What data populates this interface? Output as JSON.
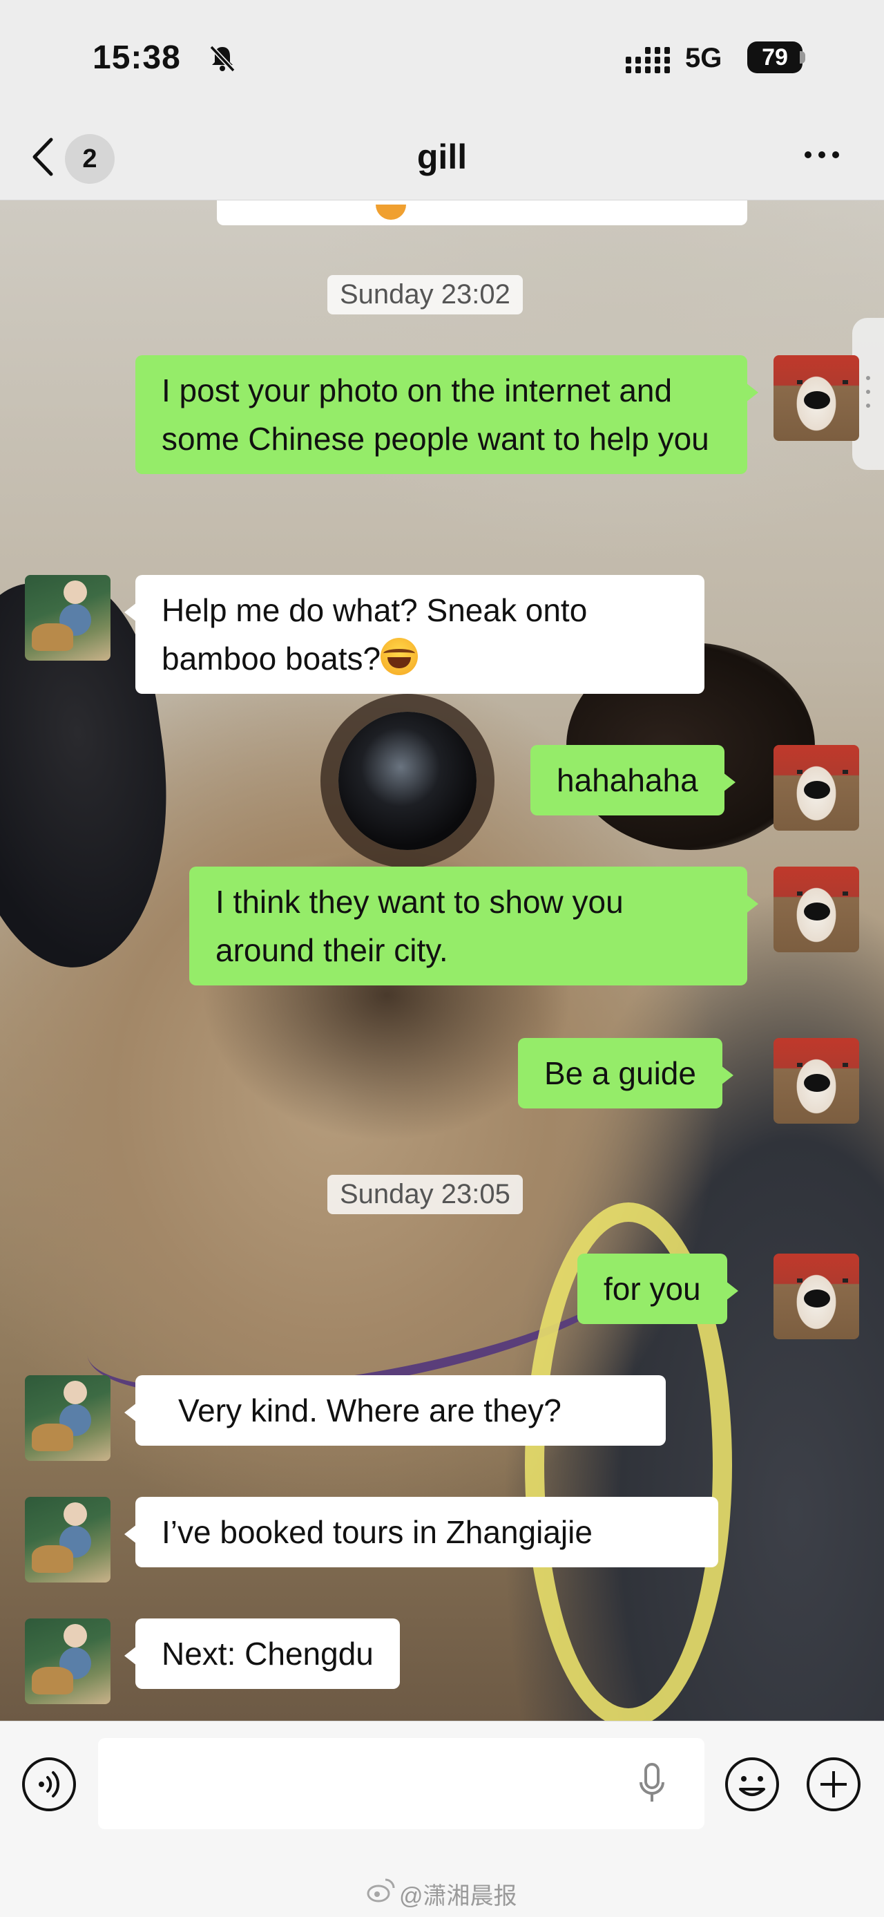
{
  "status_bar": {
    "time": "15:38",
    "network": "5G",
    "battery": "79",
    "icons": [
      "bell-muted-icon",
      "signal-icon",
      "battery-icon"
    ]
  },
  "nav": {
    "unread_count": "2",
    "title": "gill",
    "icons": [
      "back-arrow-icon",
      "more-icon"
    ]
  },
  "messages": [
    {
      "type": "timestamp",
      "text": "Sunday 23:02"
    },
    {
      "type": "msg",
      "side": "right",
      "text": "I post your photo on the internet and some Chinese people want to help you"
    },
    {
      "type": "msg",
      "side": "left",
      "text": "Help me do what? Sneak onto bamboo boats?",
      "emoji": "tears-of-joy-emoji"
    },
    {
      "type": "msg",
      "side": "right",
      "text": "hahahaha"
    },
    {
      "type": "msg",
      "side": "right",
      "text": "I think they want to show you around their city."
    },
    {
      "type": "msg",
      "side": "right",
      "text": "Be a guide"
    },
    {
      "type": "timestamp",
      "text": "Sunday 23:05"
    },
    {
      "type": "msg",
      "side": "right",
      "text": "for you"
    },
    {
      "type": "msg",
      "side": "left",
      "text": "Very kind. Where are they?"
    },
    {
      "type": "msg",
      "side": "left",
      "text": "I’ve booked tours in Zhangiajie"
    },
    {
      "type": "msg",
      "side": "left",
      "text": "Next: Chengdu"
    }
  ],
  "input_bar": {
    "value": "",
    "icons": [
      "voice-icon",
      "mic-icon",
      "emoji-icon",
      "plus-icon"
    ]
  },
  "watermark": {
    "text": "@潇湘晨报",
    "icon": "weibo-icon"
  }
}
